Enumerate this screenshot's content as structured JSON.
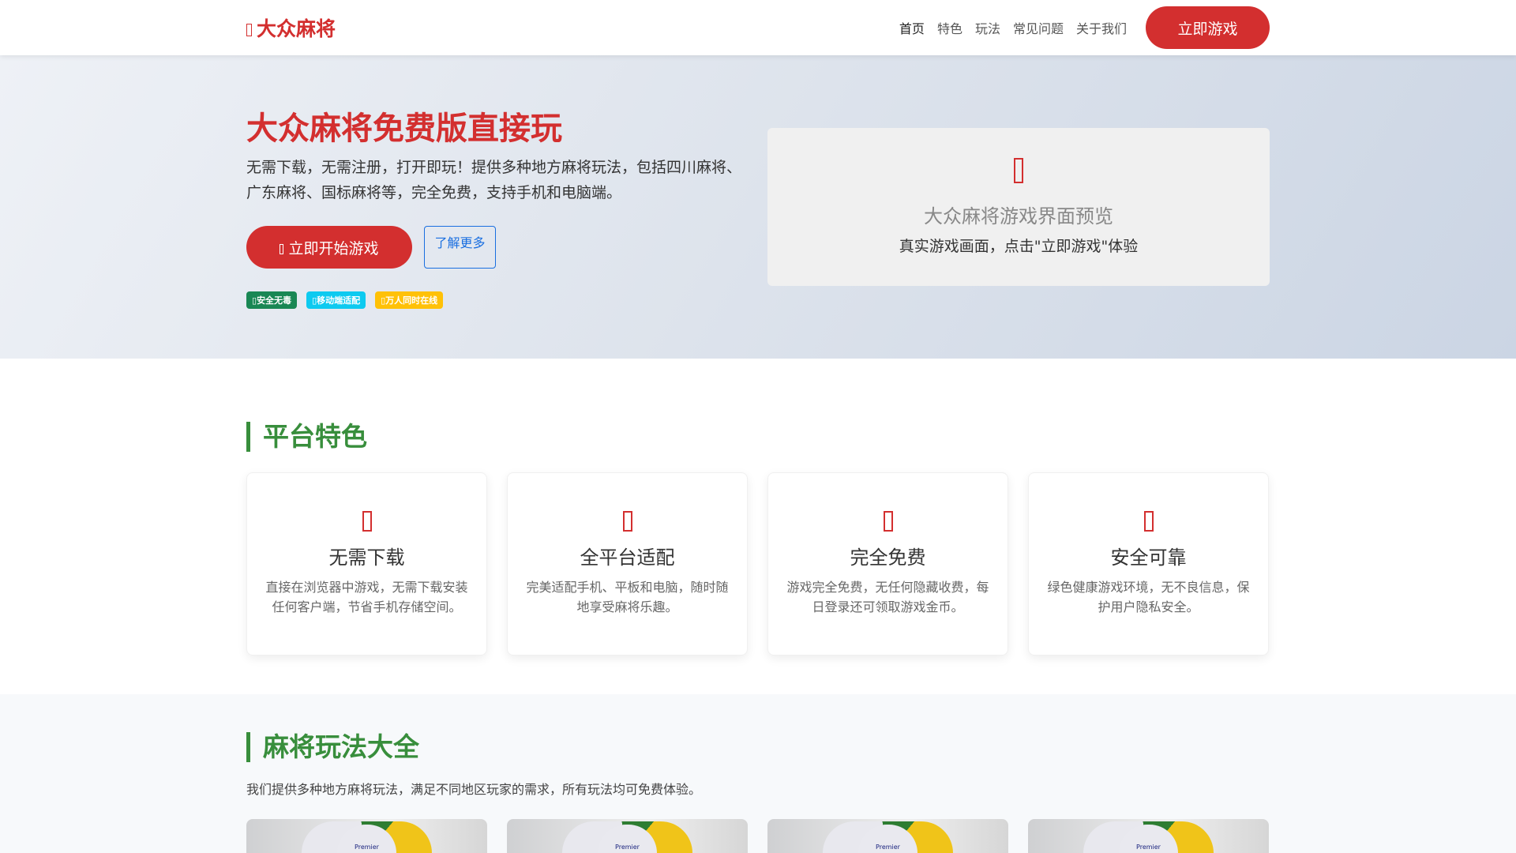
{
  "nav": {
    "logo": "大众麻将",
    "items": [
      "首页",
      "特色",
      "玩法",
      "常见问题",
      "关于我们"
    ],
    "cta": "立即游戏"
  },
  "hero": {
    "title": "大众麻将免费版直接玩",
    "desc": "无需下载，无需注册，打开即玩！提供多种地方麻将玩法，包括四川麻将、广东麻将、国标麻将等，完全免费，支持手机和电脑端。",
    "primary": "立即开始游戏",
    "secondary": "了解更多",
    "badges": [
      {
        "label": "安全无毒",
        "color": "#198754"
      },
      {
        "label": "移动端适配",
        "color": "#0dcaf0"
      },
      {
        "label": "万人同时在线",
        "color": "#ffc107"
      }
    ],
    "preview": {
      "title": "大众麻将游戏界面预览",
      "subtitle": "真实游戏画面，点击\"立即游戏\"体验"
    }
  },
  "features": {
    "title": "平台特色",
    "cards": [
      {
        "title": "无需下载",
        "desc": "直接在浏览器中游戏，无需下载安装任何客户端，节省手机存储空间。"
      },
      {
        "title": "全平台适配",
        "desc": "完美适配手机、平板和电脑，随时随地享受麻将乐趣。"
      },
      {
        "title": "完全免费",
        "desc": "游戏完全免费，无任何隐藏收费，每日登录还可领取游戏金币。"
      },
      {
        "title": "安全可靠",
        "desc": "绿色健康游戏环境，无不良信息，保护用户隐私安全。"
      }
    ]
  },
  "modes": {
    "title": "麻将玩法大全",
    "desc": "我们提供多种地方麻将玩法，满足不同地区玩家的需求，所有玩法均可免费体验。",
    "image_text": "Premier"
  }
}
